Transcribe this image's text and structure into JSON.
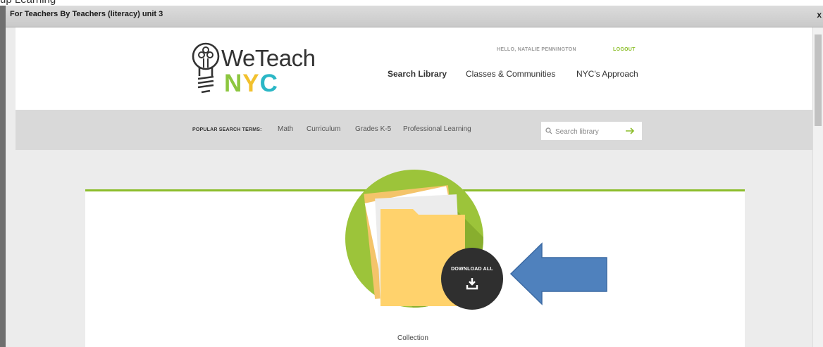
{
  "window": {
    "title": "For Teachers By Teachers (literacy) unit 3",
    "close_label": "x",
    "partial_background_text": "up Learning"
  },
  "header": {
    "logo_text": "WeTeach",
    "logo_nyc_n": "N",
    "logo_nyc_y": "Y",
    "logo_nyc_c": "C",
    "greeting": "HELLO, NATALIE PENNINGTON",
    "logout_label": "LOGOUT",
    "nav": [
      "Search Library",
      "Classes & Communities",
      "NYC's Approach"
    ]
  },
  "search_band": {
    "popular_label": "POPULAR SEARCH TERMS:",
    "terms": [
      "Math",
      "Curriculum",
      "Grades K-5",
      "Professional Learning"
    ],
    "search_placeholder": "Search library"
  },
  "content": {
    "download_all_label": "DOWNLOAD ALL",
    "collection_label": "Collection"
  },
  "colors": {
    "accent_green": "#8cbd2b",
    "circle_green": "#9cc43a",
    "annotation_blue": "#4f81bd",
    "download_button": "#2f2f2f"
  },
  "icons": [
    "lightbulb-logo-icon",
    "search-icon",
    "arrow-right-icon",
    "folder-icon",
    "download-icon",
    "arrow-left-annotation"
  ]
}
